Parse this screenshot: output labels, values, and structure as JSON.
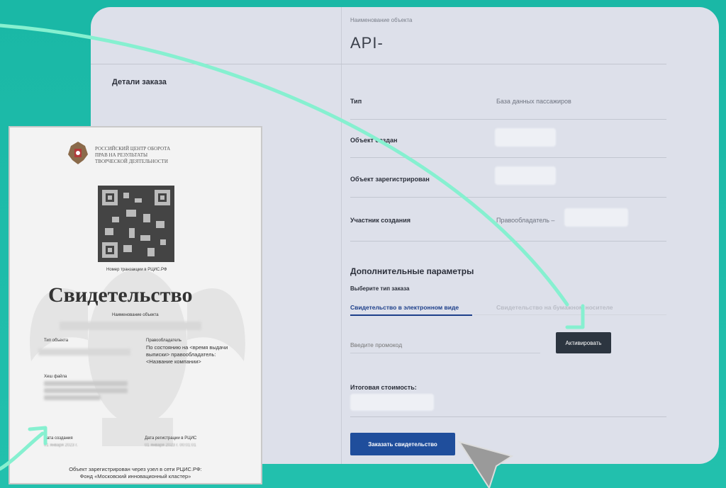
{
  "object_section": {
    "name_label": "Наименование объекта",
    "name_value": "API-"
  },
  "order_details": {
    "title": "Детали заказа",
    "rows": [
      {
        "label": "Тип",
        "value": "База данных пассажиров"
      },
      {
        "label": "Объект создан",
        "value": ""
      },
      {
        "label": "Объект зарегистрирован",
        "value": ""
      },
      {
        "label": "Участник создания",
        "value": "Правообладатель –"
      }
    ]
  },
  "extra_params": {
    "title": "Дополнительные параметры",
    "order_type_label": "Выберите тип заказа",
    "tabs": [
      {
        "label": "Свидетельство в электронном виде",
        "active": true
      },
      {
        "label": "Свидетельство на бумажном носителе",
        "active": false
      }
    ],
    "promo_placeholder": "Введите промокод",
    "activate_label": "Активировать"
  },
  "total": {
    "label": "Итоговая стоимость:"
  },
  "order_button_label": "Заказать свидетельство",
  "certificate": {
    "org_line1": "РОССИЙСКИЙ ЦЕНТР ОБОРОТА",
    "org_line2": "ПРАВ НА РЕЗУЛЬТАТЫ",
    "org_line3": "ТВОРЧЕСКОЙ ДЕЯТЕЛЬНОСТИ",
    "reg_number_label": "Номер транзакции в РЦИС.РФ",
    "title": "Свидетельство",
    "object_name_label": "Наименование объекта",
    "col_left_label": "Тип объекта",
    "col_right_label": "Правообладатель",
    "holder_text": "По состоянию на <время выдачи выписки> правообладатель: <Название компании>",
    "hash_label": "Хеш файла",
    "created_label": "Дата создания",
    "created_value": "01 января 2023 г.",
    "registered_label": "Дата регистрации в РЦИС",
    "registered_value": "01 января 2023 г. 00:01:01",
    "footer_line1": "Объект зарегистрирован через узел в сети РЦИС.РФ:",
    "footer_line2": "Фонд «Московский инновационный кластер»"
  },
  "colors": {
    "background": "#1fb9a8",
    "panel": "#dde0ea",
    "accent_blue": "#1f4e9c",
    "dark_button": "#2c3540",
    "arrow": "#7ef0cf"
  }
}
